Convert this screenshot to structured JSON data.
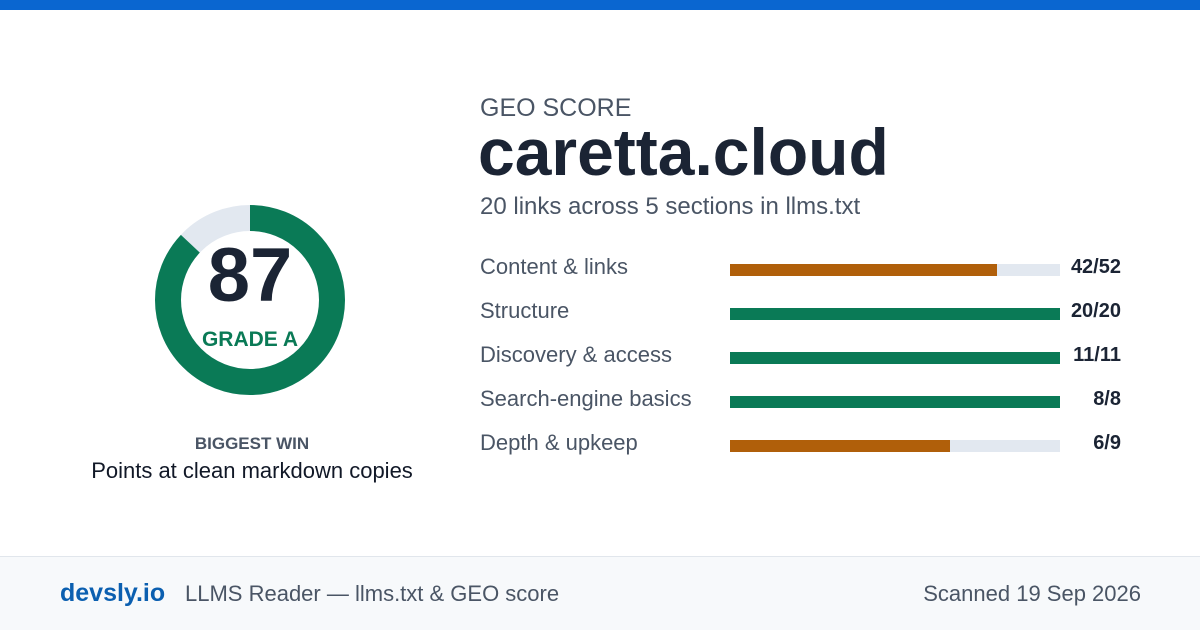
{
  "score_card": {
    "score": "87",
    "score_fraction": 0.87,
    "grade": "GRADE A",
    "colors": {
      "fill": "#0a7a56",
      "track": "#e2e8f0"
    }
  },
  "biggest_win": {
    "label": "BIGGEST WIN",
    "text": "Points at clean markdown copies"
  },
  "header": {
    "eyebrow": "GEO SCORE",
    "site": "caretta.cloud",
    "summary": "20 links across 5 sections in llms.txt"
  },
  "metrics": [
    {
      "label": "Content & links",
      "score_text": "42/52",
      "fraction": 0.8077,
      "color": "#b05f0a"
    },
    {
      "label": "Structure",
      "score_text": "20/20",
      "fraction": 1.0,
      "color": "#0a7a56"
    },
    {
      "label": "Discovery & access",
      "score_text": "11/11",
      "fraction": 1.0,
      "color": "#0a7a56"
    },
    {
      "label": "Search-engine basics",
      "score_text": "8/8",
      "fraction": 1.0,
      "color": "#0a7a56"
    },
    {
      "label": "Depth & upkeep",
      "score_text": "6/9",
      "fraction": 0.6667,
      "color": "#b05f0a"
    }
  ],
  "footer": {
    "brand": "devsly.io",
    "product": "LLMS Reader — llms.txt & GEO score",
    "scanned": "Scanned 19 Sep 2026"
  },
  "theme": {
    "accent": "#0a66d0",
    "brand": "#0b5fb0",
    "good": "#0a7a56",
    "warn": "#b05f0a"
  }
}
